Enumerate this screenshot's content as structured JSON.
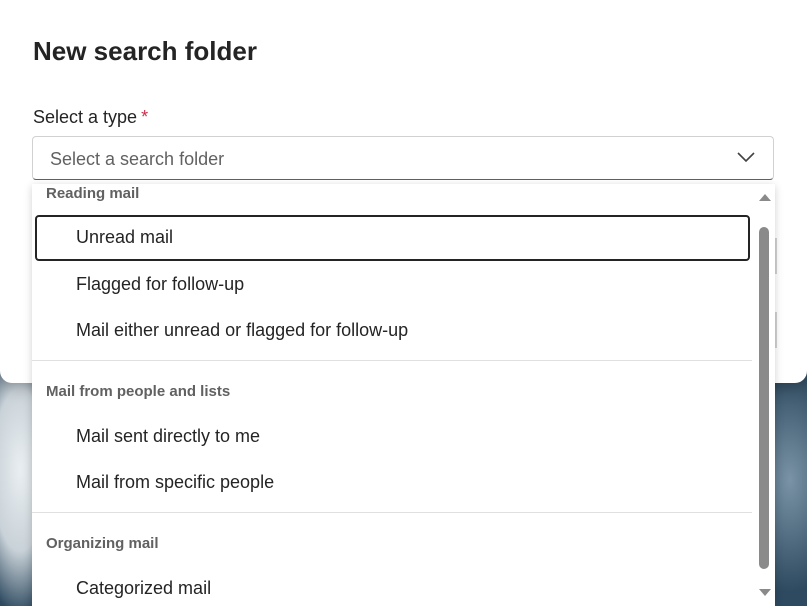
{
  "dialog": {
    "title": "New search folder",
    "field_label": "Select a type",
    "required_mark": "*",
    "placeholder": "Select a search folder"
  },
  "dropdown": {
    "groups": [
      {
        "header": "Reading mail",
        "options": [
          "Unread mail",
          "Flagged for follow-up",
          "Mail either unread or flagged for follow-up"
        ]
      },
      {
        "header": "Mail from people and lists",
        "options": [
          "Mail sent directly to me",
          "Mail from specific people"
        ]
      },
      {
        "header": "Organizing mail",
        "options": [
          "Categorized mail"
        ]
      }
    ],
    "focused_option": "Unread mail"
  },
  "colors": {
    "text": "#242424",
    "secondary_text": "#616161",
    "required": "#c4314b",
    "scroll_thumb": "#8a8a8a"
  },
  "icons": {
    "combo": "chevron-down-icon",
    "scroll_up": "triangle-up-icon",
    "scroll_down": "triangle-down-icon"
  }
}
